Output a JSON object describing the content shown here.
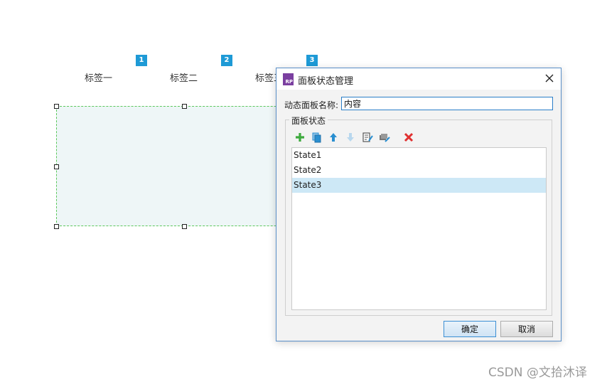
{
  "canvas": {
    "tabs": [
      {
        "badge": "1",
        "label": "标签一"
      },
      {
        "badge": "2",
        "label": "标签二"
      },
      {
        "badge": "3",
        "label": "标签三"
      }
    ]
  },
  "dialog": {
    "title": "面板状态管理",
    "app_icon_text": "RP",
    "name_label": "动态面板名称:",
    "name_value": "内容",
    "group_label": "面板状态",
    "toolbar": {
      "add_icon": "add-icon",
      "duplicate_icon": "duplicate-icon",
      "move_up_icon": "arrow-up-icon",
      "move_down_icon": "arrow-down-icon",
      "edit_icon": "edit-state-icon",
      "edit_all_icon": "edit-all-states-icon",
      "delete_icon": "delete-icon"
    },
    "states": [
      "State1",
      "State2",
      "State3"
    ],
    "selected_state": "State3",
    "ok_label": "确定",
    "cancel_label": "取消"
  },
  "watermark": "CSDN @文拾沐译",
  "colors": {
    "badge": "#1e9ad6",
    "selection": "#cde8f6",
    "panel_fill": "#eef6f7",
    "panel_border": "#5cc85c",
    "add_green": "#3daa3d",
    "delete_red": "#e03030",
    "arrow_blue": "#2a8fd0"
  }
}
